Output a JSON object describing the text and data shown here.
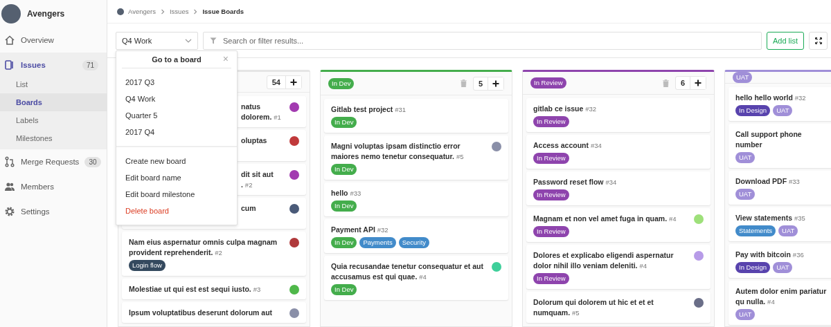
{
  "sidebar": {
    "project": "Avengers",
    "items": [
      {
        "kind": "home",
        "label": "Overview",
        "selected": false
      },
      {
        "kind": "issues",
        "label": "Issues",
        "count": "71",
        "selected": true,
        "children": [
          {
            "label": "List",
            "selected": false
          },
          {
            "label": "Boards",
            "selected": true
          },
          {
            "label": "Labels",
            "selected": false
          },
          {
            "label": "Milestones",
            "selected": false
          }
        ]
      },
      {
        "kind": "merge",
        "label": "Merge Requests",
        "count": "30",
        "selected": false
      },
      {
        "kind": "members",
        "label": "Members",
        "selected": false
      },
      {
        "kind": "settings",
        "label": "Settings",
        "selected": false
      }
    ]
  },
  "breadcrumb": [
    "Avengers",
    "Issues",
    "Issue Boards"
  ],
  "toolbar": {
    "board": "Q4 Work",
    "search": {
      "placeholder": "Search or filter results..."
    },
    "add_list": "Add list"
  },
  "board_menu": {
    "title": "Go to a board",
    "close": "×",
    "boards": [
      "2017 Q3",
      "Q4 Work",
      "Quarter 5",
      "2017 Q4"
    ],
    "actions": [
      {
        "label": "Create new board",
        "kind": "normal"
      },
      {
        "label": "Edit board name",
        "kind": "normal"
      },
      {
        "label": "Edit board milestone",
        "kind": "normal"
      },
      {
        "label": "Delete board",
        "kind": "danger"
      }
    ]
  },
  "lists": [
    {
      "count": "54",
      "color": "#e5e5e5",
      "cards": [
        {
          "covered": true,
          "title": "natus",
          "title_more": "dolorem.",
          "number": "#1",
          "avatar": {
            "color": "#a23ab0"
          }
        },
        {
          "covered": true,
          "title": "oluptas",
          "avatar": {
            "color": "#c0393b"
          }
        },
        {
          "covered": true,
          "title": "dit sit aut",
          "title_more": ".",
          "number": "#2",
          "avatar": {
            "color": "#a23ab0"
          }
        },
        {
          "covered": true,
          "title": "cum",
          "avatar": {
            "color": "#4a5a78"
          }
        },
        {
          "covered": false,
          "title": "Nam eius aspernatur omnis culpa magnam provident reprehenderit.",
          "number": "#2",
          "avatar": {
            "color": "#b0393b"
          },
          "labels": [
            {
              "text": "Login flow",
              "color": "#34495e"
            }
          ]
        },
        {
          "covered": false,
          "title": "Molestiae ut qui est est sequi iusto.",
          "number": "#3",
          "avatar": {
            "color": "#4fb84a"
          }
        },
        {
          "covered": false,
          "title": "Ipsum voluptatibus deserunt dolorum aut",
          "avatar": {
            "color": "#8a8fa8"
          }
        }
      ]
    },
    {
      "label": {
        "text": "In Dev",
        "color": "#44ad4c"
      },
      "count": "5",
      "color": "#44ad4c",
      "cards": [
        {
          "title": "Gitlab test project",
          "number": "#31",
          "labels": [
            {
              "text": "In Dev",
              "color": "#44ad4c"
            }
          ]
        },
        {
          "title": "Magni voluptas ipsam distinctio error maiores nemo tenetur consequatur.",
          "number": "#5",
          "avatar": {
            "color": "#8a8fa8"
          },
          "labels": [
            {
              "text": "In Dev",
              "color": "#44ad4c"
            }
          ]
        },
        {
          "title": "hello",
          "number": "#33",
          "labels": [
            {
              "text": "In Dev",
              "color": "#44ad4c"
            }
          ]
        },
        {
          "title": "Payment API",
          "number": "#32",
          "labels": [
            {
              "text": "In Dev",
              "color": "#44ad4c"
            },
            {
              "text": "Payments",
              "color": "#428bca"
            },
            {
              "text": "Security",
              "color": "#428bca"
            }
          ]
        },
        {
          "title": "Quia recusandae tenetur consequatur et aut accusamus est qui quae.",
          "number": "#4",
          "avatar": {
            "color": "#3ecf9a"
          },
          "labels": [
            {
              "text": "In Dev",
              "color": "#44ad4c"
            }
          ]
        }
      ]
    },
    {
      "label": {
        "text": "In Review",
        "color": "#8e44ad"
      },
      "count": "6",
      "color": "#8e44ad",
      "cards": [
        {
          "title": "gitlab ce issue",
          "number": "#32",
          "labels": [
            {
              "text": "In Review",
              "color": "#8e44ad"
            }
          ]
        },
        {
          "title": "Access account",
          "number": "#34",
          "labels": [
            {
              "text": "In Review",
              "color": "#8e44ad"
            }
          ]
        },
        {
          "title": "Password reset flow",
          "number": "#34",
          "labels": [
            {
              "text": "In Review",
              "color": "#8e44ad"
            }
          ]
        },
        {
          "title": "Magnam et non vel amet fuga in quam.",
          "number": "#4",
          "avatar": {
            "color": "#9ee07a"
          },
          "labels": [
            {
              "text": "In Review",
              "color": "#8e44ad"
            }
          ]
        },
        {
          "title": "Dolores et explicabo eligendi aspernatur dolor nihil illo veniam deleniti.",
          "number": "#4",
          "avatar": {
            "color": "#b79be8"
          },
          "labels": [
            {
              "text": "In Review",
              "color": "#8e44ad"
            }
          ]
        },
        {
          "title": "Dolorum qui dolorem ut hic et et et numquam.",
          "number": "#5",
          "avatar": {
            "color": "#6a6e88"
          }
        }
      ]
    },
    {
      "label": {
        "text": "UAT",
        "color": "#a08fd8"
      },
      "color": "#a08fd8",
      "cards": [
        {
          "title": "hello hello world",
          "number": "#32",
          "labels": [
            {
              "text": "In Design",
              "color": "#5843ad"
            },
            {
              "text": "UAT",
              "color": "#a08fd8"
            }
          ]
        },
        {
          "title": "Call support phone number",
          "labels": [
            {
              "text": "UAT",
              "color": "#a08fd8"
            }
          ]
        },
        {
          "title": "Download PDF",
          "number": "#33",
          "labels": [
            {
              "text": "UAT",
              "color": "#a08fd8"
            }
          ]
        },
        {
          "title": "View statements",
          "number": "#35",
          "labels": [
            {
              "text": "Statements",
              "color": "#428bca"
            },
            {
              "text": "UAT",
              "color": "#a08fd8"
            }
          ]
        },
        {
          "title": "Pay with bitcoin",
          "number": "#36",
          "labels": [
            {
              "text": "In Design",
              "color": "#5843ad"
            },
            {
              "text": "UAT",
              "color": "#a08fd8"
            }
          ]
        },
        {
          "title": "Autem dolor enim pariatur qu",
          "title_more": "nulla.",
          "number": "#4",
          "labels": [
            {
              "text": "UAT",
              "color": "#a08fd8"
            }
          ]
        }
      ]
    }
  ]
}
